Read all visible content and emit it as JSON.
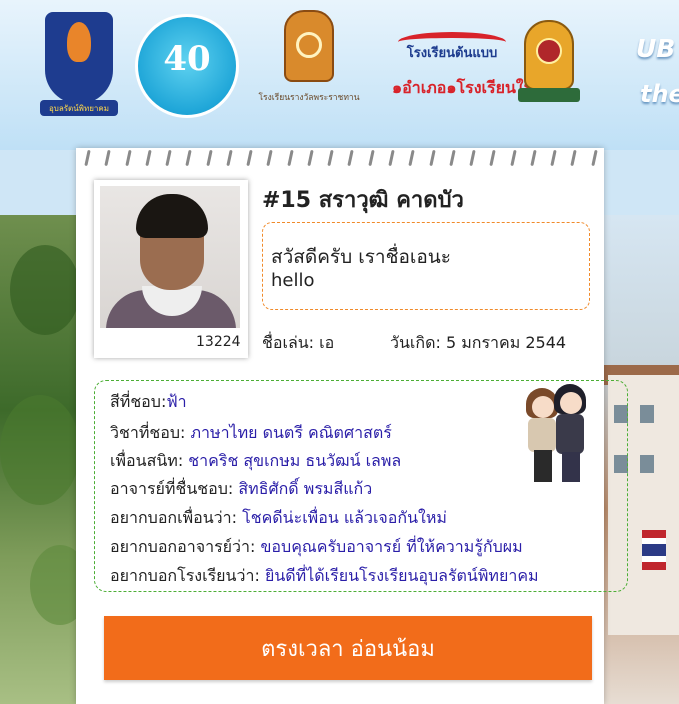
{
  "header": {
    "logos": [
      {
        "name": "school-emblem",
        "caption": "อุบลรัตน์พิทยาคม"
      },
      {
        "name": "anniversary-40",
        "number": "40"
      },
      {
        "name": "royal-award-school",
        "caption": "โรงเรียนรางวัลพระราชทาน"
      },
      {
        "name": "model-school",
        "line1": "โรงเรียนต้นแบบ",
        "line2": "๑อำเภอ๑โรงเรียนในฝัน"
      },
      {
        "name": "obec-emblem"
      }
    ],
    "tagline_line1": "UB",
    "tagline_line2": "the"
  },
  "profile": {
    "number": "#15",
    "full_name": "สราวุฒิ คาดบัว",
    "student_id": "13224",
    "message_line1": "สวัสดีครับ เราชื่อเอนะ",
    "message_line2": "hello",
    "nickname_label": "ชื่อเล่น:",
    "nickname_value": "เอ",
    "birthday_label": "วันเกิด:",
    "birthday_value": "5 มกราคม 2544"
  },
  "favorites": [
    {
      "label": "สีที่ชอบ:",
      "value": "ฟ้า"
    },
    {
      "label": "วิชาที่ชอบ:",
      "value": "ภาษาไทย ดนตรี คณิตศาสตร์"
    },
    {
      "label": "เพื่อนสนิท:",
      "value": "ชาคริช   สุขเกษม ธนวัฒน์ เลพล"
    },
    {
      "label": "อาจารย์ที่ชื่นชอบ:",
      "value": "สิทธิศักดิ์ พรมสีแก้ว"
    },
    {
      "label": "อยากบอกเพื่อนว่า:",
      "value": "โชคดีน่ะเพื่อน แล้วเจอกันใหม่"
    },
    {
      "label": "อยากบอกอาจารย์ว่า:",
      "value": "ขอบคุณครับอาจารย์ ที่ให้ความรู้กับผม"
    },
    {
      "label": "อยากบอกโรงเรียนว่า:",
      "value": "ยินดีที่ได้เรียนโรงเรียนอุบลรัตน์พิทยาคม"
    }
  ],
  "action_button": {
    "label": "ตรงเวลา อ่อนน้อม"
  },
  "colors": {
    "accent_orange": "#f26c1a",
    "value_blue": "#2a1ea8",
    "dashed_green": "#4cae35",
    "dashed_orange": "#f08a2a"
  }
}
